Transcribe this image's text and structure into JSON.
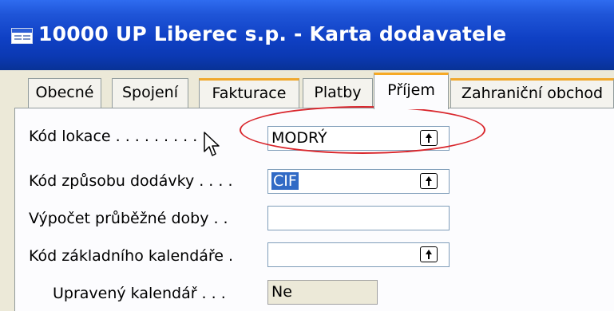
{
  "window": {
    "title": "10000 UP Liberec s.p. - Karta dodavatele"
  },
  "tabs": [
    {
      "label": "Obecné"
    },
    {
      "label": "Spojení"
    },
    {
      "label": "Fakturace"
    },
    {
      "label": "Platby"
    },
    {
      "label": "Příjem"
    },
    {
      "label": "Zahraniční obchod"
    }
  ],
  "active_tab": "Příjem",
  "fields": {
    "kod_lokace": {
      "label": "Kód lokace . . . . . . . . .",
      "value": "MODRÝ"
    },
    "kod_zpusobu_dodavky": {
      "label": "Kód způsobu dodávky . . . .",
      "value": "CIF"
    },
    "vypocet_prubezne_doby": {
      "label": "Výpočet průběžné doby . .",
      "value": ""
    },
    "kod_zakladniho_kalendare": {
      "label": "Kód základního kalendáře .",
      "value": ""
    },
    "upraveny_kalendar": {
      "label": "Upravený kalendář . . .",
      "value": "Ne"
    }
  },
  "annotation": {
    "color": "#d9262c"
  },
  "icons": [
    "window-card-icon",
    "lookup-arrow-icon",
    "mouse-cursor-icon"
  ]
}
